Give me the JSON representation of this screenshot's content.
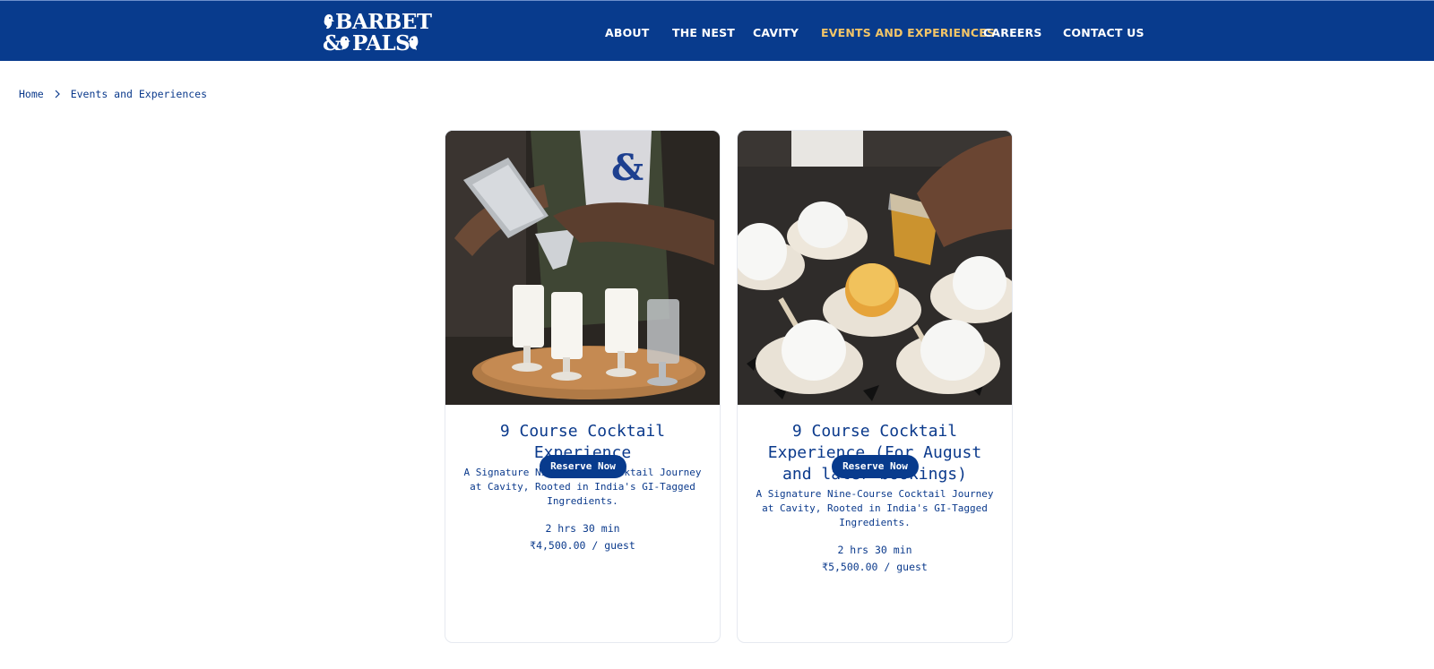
{
  "header": {
    "logo": {
      "line1": "BARBET",
      "line2": "PALS",
      "ampersand": "&"
    },
    "nav": [
      {
        "label": "ABOUT",
        "active": false
      },
      {
        "label": "THE NEST",
        "active": false
      },
      {
        "label": "CAVITY",
        "active": false
      },
      {
        "label": "EVENTS AND EXPERIENCES",
        "active": true
      },
      {
        "label": "CAREERS",
        "active": false
      },
      {
        "label": "CONTACT US",
        "active": false
      }
    ]
  },
  "breadcrumb": {
    "home": "Home",
    "current": "Events and Experiences",
    "separator_icon": "chevron-right-icon"
  },
  "cards": [
    {
      "title": "9 Course Cocktail Experience",
      "description": "A Signature Nine-Course Cocktail Journey at Cavity, Rooted in India's GI-Tagged Ingredients.",
      "duration": "2 hrs 30 min",
      "price": "₹4,500.00 / guest",
      "button": "Reserve Now"
    },
    {
      "title": "9 Course Cocktail Experience (For August and later bookings)",
      "description": "A Signature Nine-Course Cocktail Journey at Cavity, Rooted in India's GI-Tagged Ingredients.",
      "duration": "2 hrs 30 min",
      "price": "₹5,500.00 / guest",
      "button": "Reserve Now"
    }
  ],
  "colors": {
    "brand_blue": "#083b8d",
    "active_nav": "#f3c568",
    "text_blue": "#0b3a8c"
  }
}
